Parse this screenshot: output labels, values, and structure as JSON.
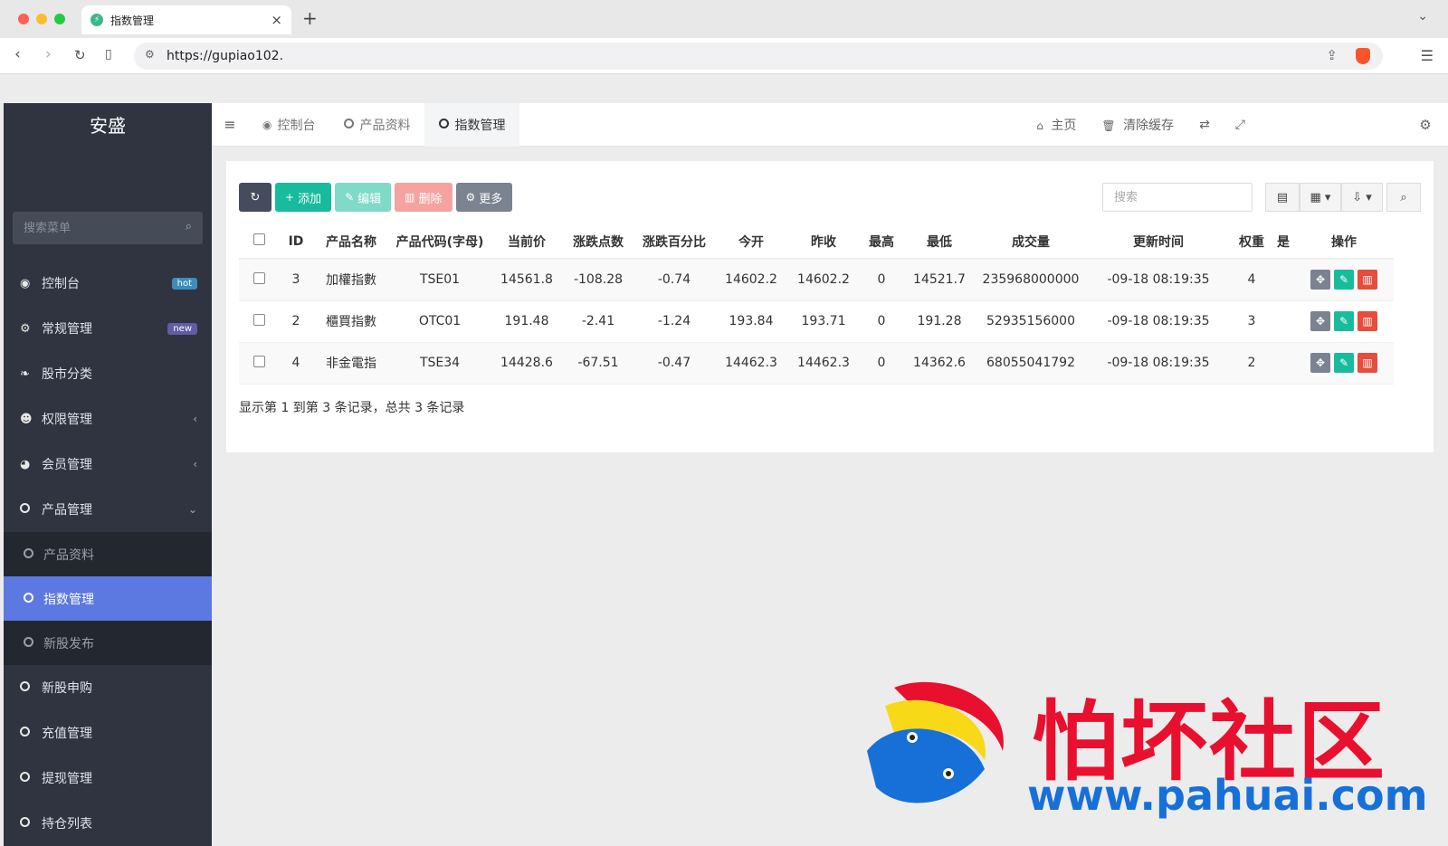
{
  "browser": {
    "tab_title": "指数管理",
    "url": "https://gupiao102."
  },
  "sidebar": {
    "brand": "安盛",
    "search_placeholder": "搜索菜单",
    "items": [
      {
        "label": "控制台",
        "icon": "dashboard-icon",
        "badge": "hot"
      },
      {
        "label": "常规管理",
        "icon": "cogs-icon",
        "badge": "new"
      },
      {
        "label": "股市分类",
        "icon": "leaf-icon"
      },
      {
        "label": "权限管理",
        "icon": "users-icon"
      },
      {
        "label": "会员管理",
        "icon": "user-circle-icon"
      },
      {
        "label": "产品管理",
        "icon": "circle-icon"
      }
    ],
    "submenu": [
      {
        "label": "产品资料"
      },
      {
        "label": "指数管理"
      },
      {
        "label": "新股发布"
      }
    ],
    "items_after": [
      {
        "label": "新股申购"
      },
      {
        "label": "充值管理"
      },
      {
        "label": "提现管理"
      },
      {
        "label": "持仓列表"
      }
    ]
  },
  "topnav": {
    "tabs": [
      "控制台",
      "产品资料",
      "指数管理"
    ],
    "home": "主页",
    "clear_cache": "清除缓存"
  },
  "toolbar": {
    "add": "添加",
    "edit": "编辑",
    "delete": "删除",
    "more": "更多",
    "search_placeholder": "搜索"
  },
  "table": {
    "headers": [
      "ID",
      "产品名称",
      "产品代码(字母)",
      "当前价",
      "涨跌点数",
      "涨跌百分比",
      "今开",
      "昨收",
      "最高",
      "最低",
      "成交量",
      "更新时间",
      "权重",
      "是",
      "操作"
    ],
    "rows": [
      [
        "3",
        "加權指數",
        "TSE01",
        "14561.8",
        "-108.28",
        "-0.74",
        "14602.2",
        "14602.2",
        "0",
        "14521.7",
        "235968000000",
        "-09-18 08:19:35",
        "4"
      ],
      [
        "2",
        "櫃買指數",
        "OTC01",
        "191.48",
        "-2.41",
        "-1.24",
        "193.84",
        "193.71",
        "0",
        "191.28",
        "52935156000",
        "-09-18 08:19:35",
        "3"
      ],
      [
        "4",
        "非金電指",
        "TSE34",
        "14428.6",
        "-67.51",
        "-0.47",
        "14462.3",
        "14462.3",
        "0",
        "14362.6",
        "68055041792",
        "-09-18 08:19:35",
        "2"
      ]
    ],
    "footer": "显示第 1 到第 3 条记录，总共 3 条记录"
  },
  "watermark": {
    "text": "怕坏社区",
    "url": "www.pahuai.com"
  },
  "colors": {
    "sidebar_bg": "#2f3440",
    "active_menu": "#5b79e0",
    "success": "#18bc9c",
    "danger": "#e74c3c"
  }
}
